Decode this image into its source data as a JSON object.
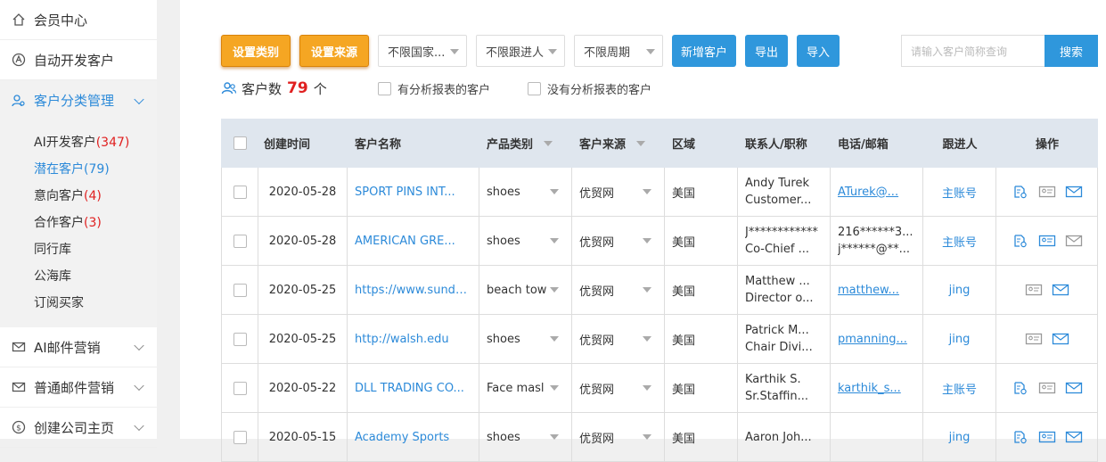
{
  "sidebar": {
    "items": [
      {
        "label": "会员中心",
        "icon": "home-icon"
      },
      {
        "label": "自动开发客户",
        "icon": "auto-icon"
      },
      {
        "label": "客户分类管理",
        "icon": "user-group-icon"
      },
      {
        "label": "AI邮件营销",
        "icon": "mail-icon"
      },
      {
        "label": "普通邮件营销",
        "icon": "mail-icon"
      },
      {
        "label": "创建公司主页",
        "icon": "dollar-icon"
      }
    ],
    "sub_items": [
      {
        "label": "AI开发客户",
        "count": "(347)"
      },
      {
        "label": "潜在客户",
        "count": "(79)"
      },
      {
        "label": "意向客户",
        "count": "(4)"
      },
      {
        "label": "合作客户",
        "count": "(3)"
      },
      {
        "label": "同行库",
        "count": ""
      },
      {
        "label": "公海库",
        "count": ""
      },
      {
        "label": "订阅买家",
        "count": ""
      }
    ]
  },
  "toolbar": {
    "set_category": "设置类别",
    "set_source": "设置来源",
    "country_filter": "不限国家...",
    "follower_filter": "不限跟进人",
    "period_filter": "不限周期",
    "add_customer": "新增客户",
    "export": "导出",
    "import": "导入",
    "search_placeholder": "请输入客户简称查询",
    "search": "搜索"
  },
  "summary": {
    "label": "客户数",
    "count": "79",
    "unit": "个",
    "has_report": "有分析报表的客户",
    "no_report": "没有分析报表的客户"
  },
  "table": {
    "headers": [
      "创建时间",
      "客户名称",
      "产品类别",
      "客户来源",
      "区域",
      "联系人/职称",
      "电话/邮箱",
      "跟进人",
      "操作"
    ],
    "rows": [
      {
        "date": "2020-05-28",
        "name": "SPORT PINS INT...",
        "category": "shoes",
        "source": "优贸网",
        "region": "美国",
        "contact1": "Andy Turek",
        "contact2": "Customer...",
        "phone": "",
        "email": "ATurek@...",
        "follower": "主账号"
      },
      {
        "date": "2020-05-28",
        "name": "AMERICAN GRE...",
        "category": "shoes",
        "source": "优贸网",
        "region": "美国",
        "contact1": "J************",
        "contact2": "Co-Chief ...",
        "phone": "216******3...",
        "email": "j******@**...",
        "follower": "主账号"
      },
      {
        "date": "2020-05-25",
        "name": "https://www.sunda...",
        "category": "beach tow",
        "source": "优贸网",
        "region": "美国",
        "contact1": "Matthew ...",
        "contact2": "Director o...",
        "phone": "",
        "email": "matthew...",
        "follower": "jing"
      },
      {
        "date": "2020-05-25",
        "name": "http://walsh.edu",
        "category": "shoes",
        "source": "优贸网",
        "region": "美国",
        "contact1": "Patrick M...",
        "contact2": "Chair Divi...",
        "phone": "",
        "email": "pmanning...",
        "follower": "jing"
      },
      {
        "date": "2020-05-22",
        "name": "DLL TRADING CO...",
        "category": "Face masl",
        "source": "优贸网",
        "region": "美国",
        "contact1": "Karthik S.",
        "contact2": "Sr.Staffin...",
        "phone": "",
        "email": "karthik_s...",
        "follower": "主账号"
      },
      {
        "date": "2020-05-15",
        "name": "Academy Sports",
        "category": "shoes",
        "source": "优贸网",
        "region": "美国",
        "contact1": "Aaron Joh...",
        "contact2": "",
        "phone": "",
        "email": "",
        "follower": "jing"
      }
    ]
  },
  "colors": {
    "accent": "#2c8ad9",
    "orange": "#f5a623",
    "count_red": "#e02020",
    "header_bg": "#dfe6ee"
  }
}
